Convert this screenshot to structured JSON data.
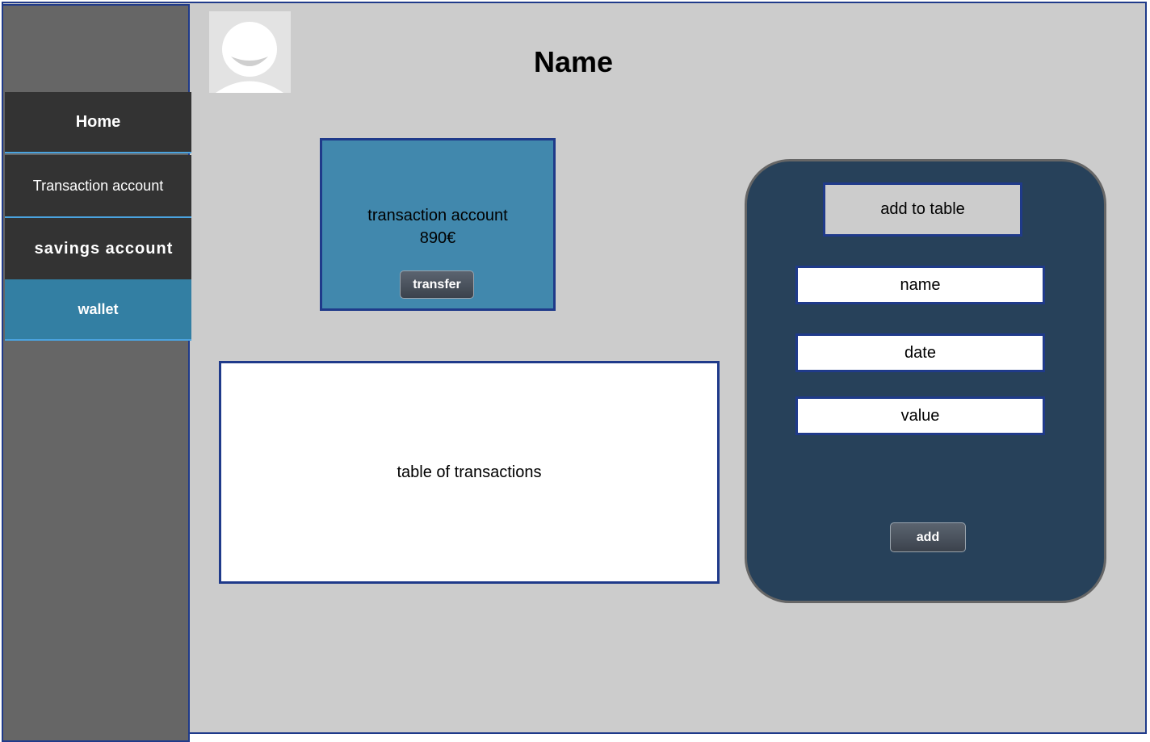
{
  "sidebar": {
    "items": [
      {
        "label": "Home"
      },
      {
        "label": "Transaction account"
      },
      {
        "label": "savings account"
      },
      {
        "label": "wallet"
      }
    ]
  },
  "header": {
    "title": "Name",
    "avatar_icon": "user-avatar-icon"
  },
  "account_card": {
    "name": "transaction account",
    "balance": "890€",
    "transfer_label": "transfer"
  },
  "transactions_table": {
    "label": "table of transactions"
  },
  "add_panel": {
    "title": "add to table",
    "fields": {
      "name": "name",
      "date": "date",
      "value": "value"
    },
    "add_label": "add"
  },
  "colors": {
    "background": "#cccccc",
    "sidebar": "#666666",
    "nav_dark": "#333333",
    "nav_active": "#337fa3",
    "card": "#4188ad",
    "panel": "#27415a",
    "border": "#1f3a8a"
  }
}
